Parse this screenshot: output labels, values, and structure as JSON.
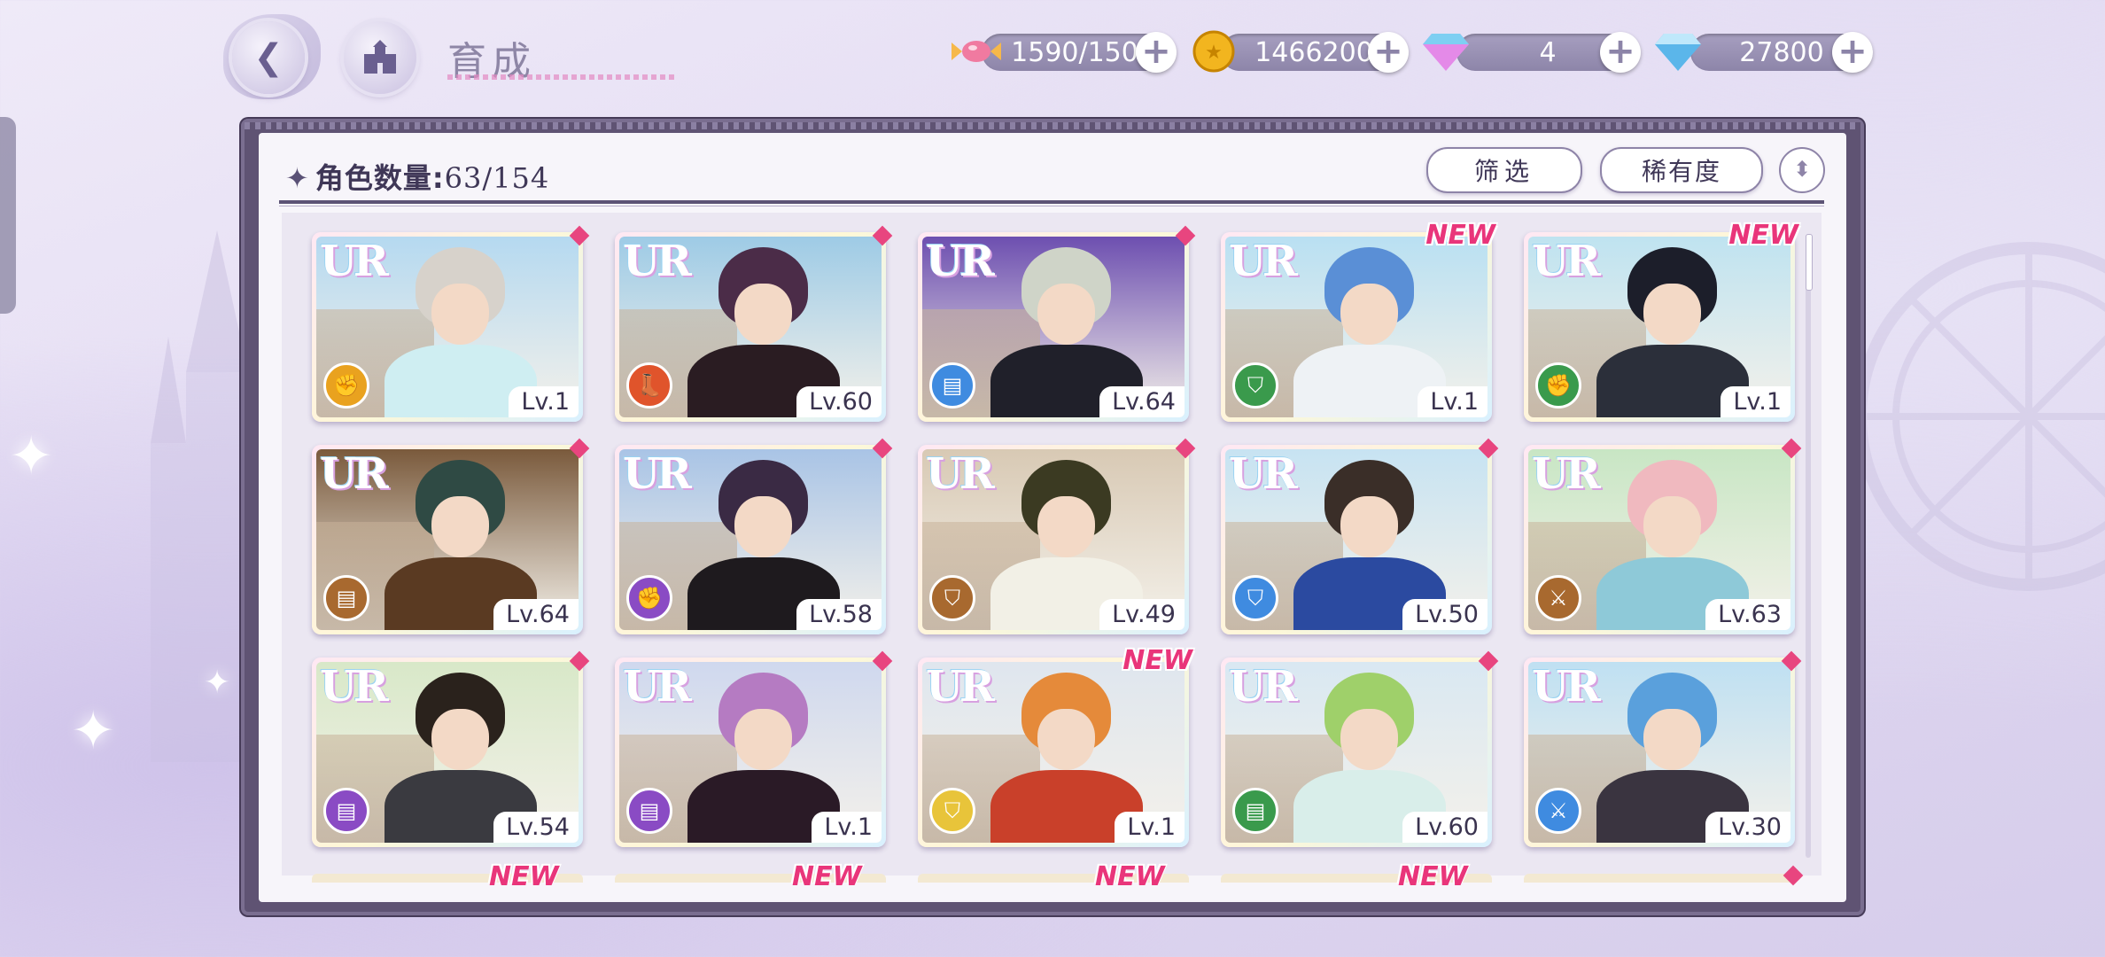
{
  "header": {
    "title": "育成",
    "back_icon": "back-arrow-icon",
    "home_icon": "castle-icon"
  },
  "resources": [
    {
      "name": "stamina",
      "icon": "candy-icon",
      "value": "1590/150"
    },
    {
      "name": "gold",
      "icon": "coin-icon",
      "value": "1466200"
    },
    {
      "name": "premium-gem",
      "icon": "pink-diamond-icon",
      "value": "4"
    },
    {
      "name": "gem",
      "icon": "blue-diamond-icon",
      "value": "27800"
    }
  ],
  "panel": {
    "count_label": "角色数量:",
    "count_value": "63/154",
    "filter_label": "筛选",
    "sort_label": "稀有度"
  },
  "cards": [
    {
      "rarity": "UR",
      "level": "Lv.1",
      "attr": "fist-icon",
      "attr_color": "#e9a21f",
      "badge": "diamond",
      "hair": "#d7d2cb",
      "outfit": "#cfeef2",
      "sky": "#b5d9f0"
    },
    {
      "rarity": "UR",
      "level": "Lv.60",
      "attr": "boot-icon",
      "attr_color": "#e0542b",
      "badge": "diamond",
      "hair": "#4b2c48",
      "outfit": "#2a1c22",
      "sky": "#9ecbe6"
    },
    {
      "rarity": "UR",
      "level": "Lv.64",
      "attr": "book-icon",
      "attr_color": "#3f8be0",
      "badge": "diamond",
      "hair": "#cfd4c8",
      "outfit": "#20202a",
      "sky": "#6d4fb0"
    },
    {
      "rarity": "UR",
      "level": "Lv.1",
      "attr": "shield-icon",
      "attr_color": "#3a9a4c",
      "badge": "new",
      "hair": "#5a8fd6",
      "outfit": "#eef2f5",
      "sky": "#b9e0f2"
    },
    {
      "rarity": "UR",
      "level": "Lv.1",
      "attr": "fist-icon",
      "attr_color": "#3a9a4c",
      "badge": "new",
      "hair": "#1c1e2a",
      "outfit": "#2b2f3a",
      "sky": "#bfe3f0"
    },
    {
      "rarity": "UR",
      "level": "Lv.64",
      "attr": "book-icon",
      "attr_color": "#a8692f",
      "badge": "diamond",
      "hair": "#2f4a44",
      "outfit": "#5a3a22",
      "sky": "#7a5a3c"
    },
    {
      "rarity": "UR",
      "level": "Lv.58",
      "attr": "fist-icon",
      "attr_color": "#8a4bc4",
      "badge": "diamond",
      "hair": "#3a2a44",
      "outfit": "#1e1a1e",
      "sky": "#a9c4e6"
    },
    {
      "rarity": "UR",
      "level": "Lv.49",
      "attr": "shield-icon",
      "attr_color": "#a8692f",
      "badge": "diamond",
      "hair": "#3b3a22",
      "outfit": "#f2f0e6",
      "sky": "#d8c9b4"
    },
    {
      "rarity": "UR",
      "level": "Lv.50",
      "attr": "shield-icon",
      "attr_color": "#3f8be0",
      "badge": "diamond",
      "hair": "#3a2e28",
      "outfit": "#2b4aa0",
      "sky": "#c7e3f2"
    },
    {
      "rarity": "UR",
      "level": "Lv.63",
      "attr": "sword-icon",
      "attr_color": "#a8692f",
      "badge": "diamond",
      "hair": "#f0b9bf",
      "outfit": "#8ec9d8",
      "sky": "#c8e6c4"
    },
    {
      "rarity": "UR",
      "level": "Lv.54",
      "attr": "book-icon",
      "attr_color": "#8a4bc4",
      "badge": "diamond",
      "hair": "#2a221c",
      "outfit": "#3a3a40",
      "sky": "#d8e8c8"
    },
    {
      "rarity": "UR",
      "level": "Lv.1",
      "attr": "book-icon",
      "attr_color": "#8a4bc4",
      "badge": "diamond",
      "hair": "#b57bc2",
      "outfit": "#2a1a26",
      "sky": "#cfd8ee"
    },
    {
      "rarity": "UR",
      "level": "Lv.1",
      "attr": "shield-icon",
      "attr_color": "#e8c43a",
      "badge": "new",
      "hair": "#e58a3a",
      "outfit": "#c9402a",
      "sky": "#dfe6ee"
    },
    {
      "rarity": "UR",
      "level": "Lv.60",
      "attr": "book-icon",
      "attr_color": "#3a9a4c",
      "badge": "diamond",
      "hair": "#9fd06a",
      "outfit": "#d9eeea",
      "sky": "#d9e8f2"
    },
    {
      "rarity": "UR",
      "level": "Lv.30",
      "attr": "sword-icon",
      "attr_color": "#3f8be0",
      "badge": "diamond",
      "hair": "#5aa0dc",
      "outfit": "#3a3440",
      "sky": "#bfe0f2"
    }
  ],
  "next_row_badges": [
    "NEW",
    "NEW",
    "NEW",
    "NEW",
    ""
  ]
}
